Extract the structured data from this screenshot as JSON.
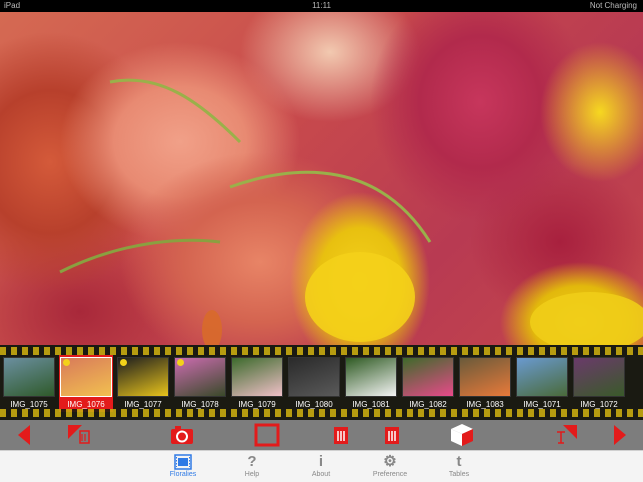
{
  "status_bar": {
    "left": "iPad",
    "center": "11:11",
    "right": "Not Charging"
  },
  "filmstrip": {
    "thumbnails": [
      {
        "label": "IMG_1075",
        "color_a": "#6b8fa0",
        "color_b": "#2f5a2a",
        "dot": false,
        "selected": false
      },
      {
        "label": "IMG_1076",
        "color_a": "#d87a5a",
        "color_b": "#f2c050",
        "dot": true,
        "selected": true
      },
      {
        "label": "IMG_1077",
        "color_a": "#1e1e1e",
        "color_b": "#e8c41c",
        "dot": true,
        "selected": false
      },
      {
        "label": "IMG_1078",
        "color_a": "#cc6cb0",
        "color_b": "#3a4a2a",
        "dot": true,
        "selected": false
      },
      {
        "label": "IMG_1079",
        "color_a": "#3c6a2c",
        "color_b": "#f0c0c8",
        "dot": false,
        "selected": false
      },
      {
        "label": "IMG_1080",
        "color_a": "#2a2a2a",
        "color_b": "#5a5a5a",
        "dot": false,
        "selected": false
      },
      {
        "label": "IMG_1081",
        "color_a": "#2e5a22",
        "color_b": "#f4f4f4",
        "dot": false,
        "selected": false
      },
      {
        "label": "IMG_1082",
        "color_a": "#3e6a2a",
        "color_b": "#e84a8a",
        "dot": false,
        "selected": false
      },
      {
        "label": "IMG_1083",
        "color_a": "#6a5a3a",
        "color_b": "#e87a3a",
        "dot": false,
        "selected": false
      },
      {
        "label": "IMG_1071",
        "color_a": "#6a9ad0",
        "color_b": "#4a6a3a",
        "dot": false,
        "selected": false
      },
      {
        "label": "IMG_1072",
        "color_a": "#6a3a6a",
        "color_b": "#3a5a2a",
        "dot": false,
        "selected": false
      }
    ]
  },
  "toolbar": {
    "accent": "#e31b1b",
    "buttons": [
      "previous-arrow",
      "delete-corner",
      "camera",
      "frame",
      "delete-left",
      "delete-right",
      "tag-cube",
      "text-corner",
      "next-arrow"
    ]
  },
  "tabs": [
    {
      "label": "Floralies",
      "icon": "filmstrip-icon",
      "glyph": "",
      "active": true
    },
    {
      "label": "Help",
      "icon": "help-icon",
      "glyph": "?",
      "active": false
    },
    {
      "label": "About",
      "icon": "info-icon",
      "glyph": "i",
      "active": false
    },
    {
      "label": "Preference",
      "icon": "gear-icon",
      "glyph": "⚙",
      "active": false
    },
    {
      "label": "Tables",
      "icon": "tables-icon",
      "glyph": "t",
      "active": false
    }
  ]
}
